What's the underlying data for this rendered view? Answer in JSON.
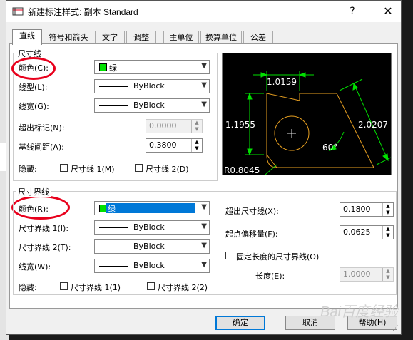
{
  "window": {
    "title": "新建标注样式: 副本 Standard",
    "help_glyph": "?",
    "close_glyph": "✕"
  },
  "tabs": [
    "直线",
    "符号和箭头",
    "文字",
    "调整",
    "主单位",
    "换算单位",
    "公差"
  ],
  "dim_lines": {
    "group_label": "尺寸线",
    "color_label": "颜色(C):",
    "color_value": "绿",
    "linetype_label": "线型(L):",
    "linetype_value": "ByBlock",
    "lineweight_label": "线宽(G):",
    "lineweight_value": "ByBlock",
    "extend_label": "超出标记(N):",
    "extend_value": "0.0000",
    "baseline_label": "基线间距(A):",
    "baseline_value": "0.3800",
    "suppress_label": "隐藏:",
    "suppress_1": "尺寸线 1(M)",
    "suppress_2": "尺寸线 2(D)"
  },
  "ext_lines": {
    "group_label": "尺寸界线",
    "color_label": "颜色(R):",
    "color_value": "绿",
    "lt1_label": "尺寸界线 1(I):",
    "lt1_value": "ByBlock",
    "lt2_label": "尺寸界线 2(T):",
    "lt2_value": "ByBlock",
    "lineweight_label": "线宽(W):",
    "lineweight_value": "ByBlock",
    "suppress_label": "隐藏:",
    "suppress_1": "尺寸界线 1(1)",
    "suppress_2": "尺寸界线 2(2)",
    "beyond_label": "超出尺寸线(X):",
    "beyond_value": "0.1800",
    "offset_label": "起点偏移量(F):",
    "offset_value": "0.0625",
    "fixed_label": "固定长度的尺寸界线(O)",
    "length_label": "长度(E):",
    "length_value": "1.0000"
  },
  "preview": {
    "dim_top": "1.0159",
    "dim_left": "1.1955",
    "dim_right": "2.0207",
    "angle": "60°",
    "radius": "R0.8045"
  },
  "buttons": {
    "ok": "确定",
    "cancel": "取消",
    "help": "帮助(H)"
  },
  "watermark": "Bai百度经验",
  "colors": {
    "accent": "#0078d7",
    "green": "#00e000",
    "annotation": "#e8001c",
    "preview_line": "#e8a020"
  }
}
